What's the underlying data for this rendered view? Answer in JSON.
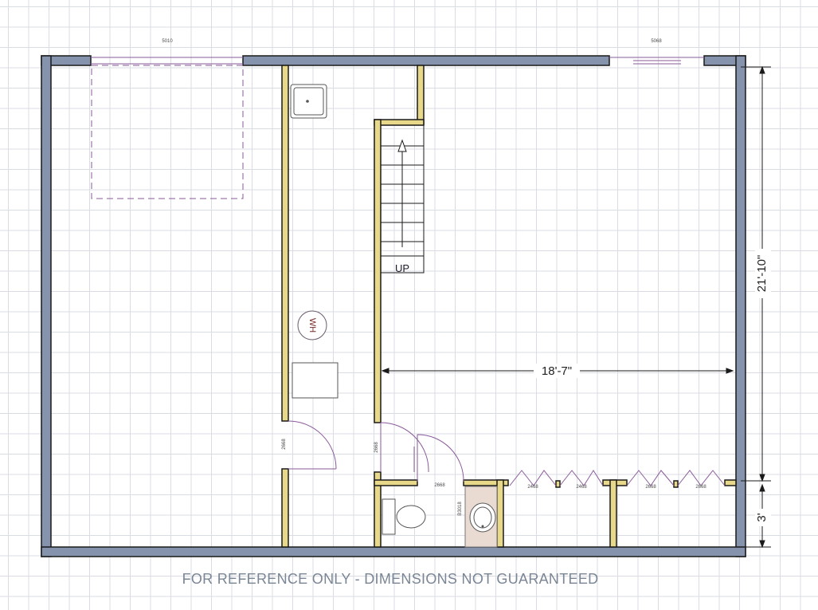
{
  "plan": {
    "window_top_left": "5010",
    "window_top_right": "5068",
    "stair_label": "UP",
    "water_heater_label": "WH",
    "door_utility": "2668",
    "door_hall": "2668",
    "door_bath": "2668",
    "vanity_label": "B3018",
    "closet_door_1": "2468",
    "closet_door_2": "2468",
    "closet_door_3": "2668",
    "closet_door_4": "2668",
    "dim_width": "18'-7\"",
    "dim_height": "21'-10\"",
    "dim_closet": "3'",
    "disclaimer": "FOR REFERENCE ONLY - DIMENSIONS NOT GUARANTEED"
  },
  "colors": {
    "exterior_wall": "#8593ad",
    "interior_wall": "#e8d98a",
    "wall_outline": "#1a1a1a",
    "door_swing": "#8a5a9a",
    "fixture_fill": "#ffffff",
    "vanity_fill": "#e9dad2"
  }
}
